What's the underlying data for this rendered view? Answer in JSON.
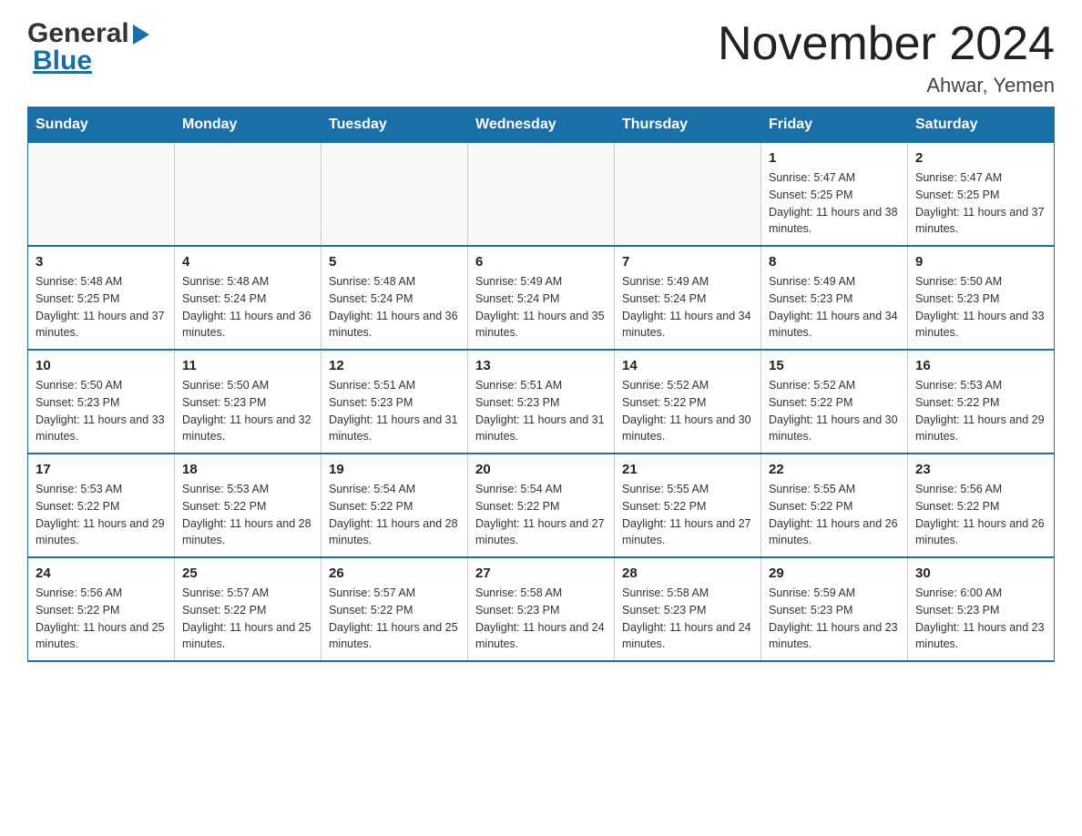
{
  "header": {
    "logo_general": "General",
    "logo_blue": "Blue",
    "month_title": "November 2024",
    "location": "Ahwar, Yemen"
  },
  "days_of_week": [
    "Sunday",
    "Monday",
    "Tuesday",
    "Wednesday",
    "Thursday",
    "Friday",
    "Saturday"
  ],
  "weeks": [
    [
      {
        "day": "",
        "info": ""
      },
      {
        "day": "",
        "info": ""
      },
      {
        "day": "",
        "info": ""
      },
      {
        "day": "",
        "info": ""
      },
      {
        "day": "",
        "info": ""
      },
      {
        "day": "1",
        "info": "Sunrise: 5:47 AM\nSunset: 5:25 PM\nDaylight: 11 hours and 38 minutes."
      },
      {
        "day": "2",
        "info": "Sunrise: 5:47 AM\nSunset: 5:25 PM\nDaylight: 11 hours and 37 minutes."
      }
    ],
    [
      {
        "day": "3",
        "info": "Sunrise: 5:48 AM\nSunset: 5:25 PM\nDaylight: 11 hours and 37 minutes."
      },
      {
        "day": "4",
        "info": "Sunrise: 5:48 AM\nSunset: 5:24 PM\nDaylight: 11 hours and 36 minutes."
      },
      {
        "day": "5",
        "info": "Sunrise: 5:48 AM\nSunset: 5:24 PM\nDaylight: 11 hours and 36 minutes."
      },
      {
        "day": "6",
        "info": "Sunrise: 5:49 AM\nSunset: 5:24 PM\nDaylight: 11 hours and 35 minutes."
      },
      {
        "day": "7",
        "info": "Sunrise: 5:49 AM\nSunset: 5:24 PM\nDaylight: 11 hours and 34 minutes."
      },
      {
        "day": "8",
        "info": "Sunrise: 5:49 AM\nSunset: 5:23 PM\nDaylight: 11 hours and 34 minutes."
      },
      {
        "day": "9",
        "info": "Sunrise: 5:50 AM\nSunset: 5:23 PM\nDaylight: 11 hours and 33 minutes."
      }
    ],
    [
      {
        "day": "10",
        "info": "Sunrise: 5:50 AM\nSunset: 5:23 PM\nDaylight: 11 hours and 33 minutes."
      },
      {
        "day": "11",
        "info": "Sunrise: 5:50 AM\nSunset: 5:23 PM\nDaylight: 11 hours and 32 minutes."
      },
      {
        "day": "12",
        "info": "Sunrise: 5:51 AM\nSunset: 5:23 PM\nDaylight: 11 hours and 31 minutes."
      },
      {
        "day": "13",
        "info": "Sunrise: 5:51 AM\nSunset: 5:23 PM\nDaylight: 11 hours and 31 minutes."
      },
      {
        "day": "14",
        "info": "Sunrise: 5:52 AM\nSunset: 5:22 PM\nDaylight: 11 hours and 30 minutes."
      },
      {
        "day": "15",
        "info": "Sunrise: 5:52 AM\nSunset: 5:22 PM\nDaylight: 11 hours and 30 minutes."
      },
      {
        "day": "16",
        "info": "Sunrise: 5:53 AM\nSunset: 5:22 PM\nDaylight: 11 hours and 29 minutes."
      }
    ],
    [
      {
        "day": "17",
        "info": "Sunrise: 5:53 AM\nSunset: 5:22 PM\nDaylight: 11 hours and 29 minutes."
      },
      {
        "day": "18",
        "info": "Sunrise: 5:53 AM\nSunset: 5:22 PM\nDaylight: 11 hours and 28 minutes."
      },
      {
        "day": "19",
        "info": "Sunrise: 5:54 AM\nSunset: 5:22 PM\nDaylight: 11 hours and 28 minutes."
      },
      {
        "day": "20",
        "info": "Sunrise: 5:54 AM\nSunset: 5:22 PM\nDaylight: 11 hours and 27 minutes."
      },
      {
        "day": "21",
        "info": "Sunrise: 5:55 AM\nSunset: 5:22 PM\nDaylight: 11 hours and 27 minutes."
      },
      {
        "day": "22",
        "info": "Sunrise: 5:55 AM\nSunset: 5:22 PM\nDaylight: 11 hours and 26 minutes."
      },
      {
        "day": "23",
        "info": "Sunrise: 5:56 AM\nSunset: 5:22 PM\nDaylight: 11 hours and 26 minutes."
      }
    ],
    [
      {
        "day": "24",
        "info": "Sunrise: 5:56 AM\nSunset: 5:22 PM\nDaylight: 11 hours and 25 minutes."
      },
      {
        "day": "25",
        "info": "Sunrise: 5:57 AM\nSunset: 5:22 PM\nDaylight: 11 hours and 25 minutes."
      },
      {
        "day": "26",
        "info": "Sunrise: 5:57 AM\nSunset: 5:22 PM\nDaylight: 11 hours and 25 minutes."
      },
      {
        "day": "27",
        "info": "Sunrise: 5:58 AM\nSunset: 5:23 PM\nDaylight: 11 hours and 24 minutes."
      },
      {
        "day": "28",
        "info": "Sunrise: 5:58 AM\nSunset: 5:23 PM\nDaylight: 11 hours and 24 minutes."
      },
      {
        "day": "29",
        "info": "Sunrise: 5:59 AM\nSunset: 5:23 PM\nDaylight: 11 hours and 23 minutes."
      },
      {
        "day": "30",
        "info": "Sunrise: 6:00 AM\nSunset: 5:23 PM\nDaylight: 11 hours and 23 minutes."
      }
    ]
  ]
}
